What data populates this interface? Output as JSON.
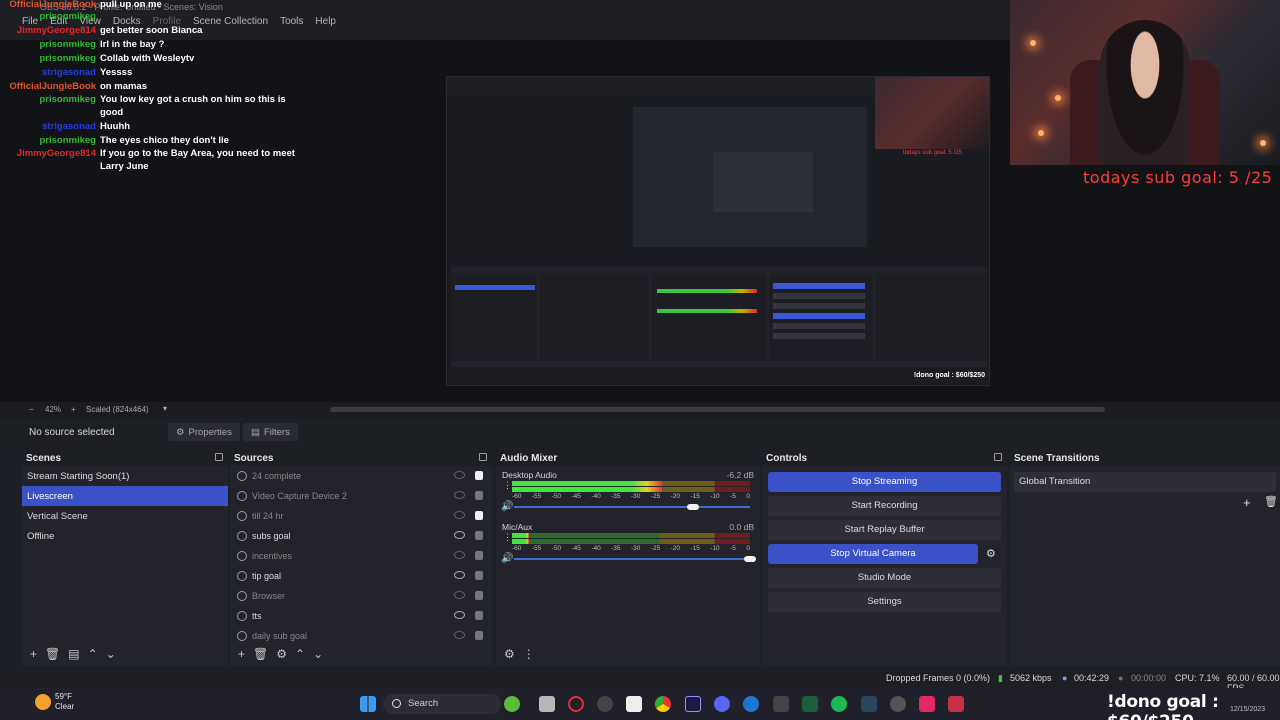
{
  "window": {
    "title": "OBS 30.0.2 - Profile: Untitled - Scenes: Vision"
  },
  "menu": [
    "File",
    "Edit",
    "View",
    "Docks",
    "Profile",
    "Scene Collection",
    "Tools",
    "Help"
  ],
  "chat": [
    {
      "user": "OfficialJungleBook",
      "color": "#e0532b",
      "msg": "pull up on me"
    },
    {
      "user": "prisonmikeg",
      "color": "#35b635",
      "msg": ""
    },
    {
      "user": "JimmyGeorge814",
      "color": "#e02a2a",
      "msg": "get better soon Bianca"
    },
    {
      "user": "prisonmikeg",
      "color": "#35b635",
      "msg": "lrl in the bay ?"
    },
    {
      "user": "prisonmikeg",
      "color": "#35b635",
      "msg": "Collab with Wesleytv"
    },
    {
      "user": "strigasonad",
      "color": "#2a3ae0",
      "msg": "Yessss"
    },
    {
      "user": "OfficialJungleBook",
      "color": "#e0532b",
      "msg": "on mamas"
    },
    {
      "user": "prisonmikeg",
      "color": "#35b635",
      "msg": "You low key got a crush on him so this is good"
    },
    {
      "user": "strigasonad",
      "color": "#2a3ae0",
      "msg": "Huuhh"
    },
    {
      "user": "prisonmikeg",
      "color": "#35b635",
      "msg": "The eyes chico they don't lie"
    },
    {
      "user": "JimmyGeorge814",
      "color": "#e02a2a",
      "msg": "If you go to the Bay Area, you need to meet Larry June"
    }
  ],
  "overlay": {
    "sub_goal": "todays sub goal: 5 /25",
    "dono_goal": "!dono goal : $60/$250"
  },
  "zoom": {
    "minus": "−",
    "value": "42%",
    "plus": "+",
    "mode": "Scaled (824x464)"
  },
  "source_toolbar": {
    "no_source": "No source selected",
    "properties": "Properties",
    "filters": "Filters"
  },
  "scenes": {
    "title": "Scenes",
    "items": [
      "Stream Starting Soon(1)",
      "Livescreen",
      "Vertical Scene",
      "Offline"
    ],
    "active_index": 1
  },
  "sources": {
    "title": "Sources",
    "items": [
      {
        "name": "24 complete",
        "icon": "globe-icon",
        "visible": false,
        "locked": true
      },
      {
        "name": "Video Capture Device 2",
        "icon": "camera-icon",
        "visible": false,
        "locked": false
      },
      {
        "name": "till 24 hr",
        "icon": "globe-icon",
        "visible": false,
        "locked": true
      },
      {
        "name": "subs goal",
        "icon": "globe-icon",
        "visible": true,
        "locked": false
      },
      {
        "name": "incentives",
        "icon": "globe-icon",
        "visible": false,
        "locked": false
      },
      {
        "name": "tip goal",
        "icon": "globe-icon",
        "visible": true,
        "locked": false
      },
      {
        "name": "Browser",
        "icon": "globe-icon",
        "visible": false,
        "locked": false
      },
      {
        "name": "tts",
        "icon": "globe-icon",
        "visible": true,
        "locked": false
      },
      {
        "name": "daily sub goal",
        "icon": "globe-icon",
        "visible": false,
        "locked": false
      }
    ]
  },
  "mixer": {
    "title": "Audio Mixer",
    "channels": [
      {
        "name": "Desktop Audio",
        "db": "-6.2 dB",
        "level": 0.63,
        "volume": 0.76
      },
      {
        "name": "Mic/Aux",
        "db": "0.0 dB",
        "level": 0.07,
        "volume": 1.0
      }
    ],
    "ticks": [
      "-60",
      "-55",
      "-50",
      "-45",
      "-40",
      "-35",
      "-30",
      "-25",
      "-20",
      "-15",
      "-10",
      "-5",
      "0"
    ]
  },
  "controls": {
    "title": "Controls",
    "buttons": [
      {
        "label": "Stop Streaming",
        "active": true
      },
      {
        "label": "Start Recording",
        "active": false
      },
      {
        "label": "Start Replay Buffer",
        "active": false
      },
      {
        "label": "Stop Virtual Camera",
        "active": true
      },
      {
        "label": "Studio Mode",
        "active": false
      },
      {
        "label": "Settings",
        "active": false
      }
    ]
  },
  "transitions": {
    "title": "Scene Transitions",
    "selected": "Global Transition"
  },
  "status": {
    "dropped": "Dropped Frames 0 (0.0%)",
    "bitrate": "5062 kbps",
    "live_time": "00:42:29",
    "rec_time": "00:00:00",
    "cpu": "CPU: 7.1%",
    "fps": "60.00 / 60.00 FPS"
  },
  "taskbar": {
    "temp": "59°F",
    "condition": "Clear",
    "search_label": "Search",
    "date": "12/15/2023"
  },
  "colors": {
    "accent": "#3a51c8",
    "panel": "#23242b",
    "dark": "#1d1f26"
  }
}
